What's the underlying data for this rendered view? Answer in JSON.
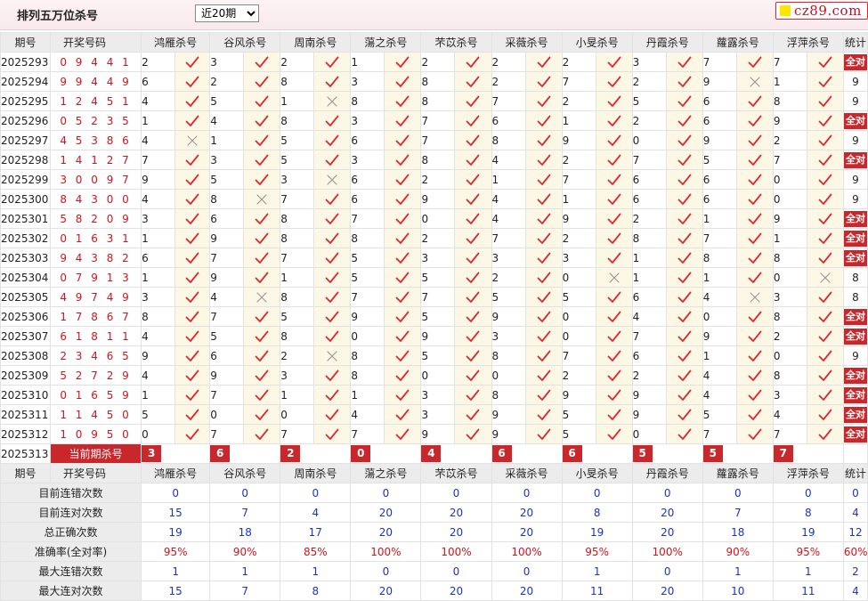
{
  "header": {
    "title": "排列五万位杀号",
    "range_selected": "近20期",
    "range_options": [
      "近20期"
    ],
    "site_logo": "cz89.com",
    "colors": {
      "accent": "#c8282c",
      "winning": "#d0141c",
      "stat_value": "#1a33c8"
    }
  },
  "columns": {
    "period": "期号",
    "draw": "开奖号码",
    "experts": [
      "鸿雁杀号",
      "谷风杀号",
      "周南杀号",
      "蕩之杀号",
      "芣苡杀号",
      "采薇杀号",
      "小旻杀号",
      "丹霞杀号",
      "蘿露杀号",
      "浮萍杀号"
    ],
    "stats": "统计"
  },
  "rows": [
    {
      "period": "2025293",
      "draw": "09441",
      "p": [
        2,
        3,
        2,
        1,
        2,
        2,
        2,
        3,
        7,
        7
      ],
      "ok": [
        1,
        1,
        1,
        1,
        1,
        1,
        1,
        1,
        1,
        1
      ],
      "stat": "全对"
    },
    {
      "period": "2025294",
      "draw": "99449",
      "p": [
        6,
        2,
        8,
        3,
        8,
        2,
        7,
        2,
        9,
        1
      ],
      "ok": [
        1,
        1,
        1,
        1,
        1,
        1,
        1,
        1,
        0,
        1
      ],
      "stat": "9"
    },
    {
      "period": "2025295",
      "draw": "12451",
      "p": [
        4,
        5,
        1,
        8,
        8,
        7,
        2,
        5,
        6,
        8
      ],
      "ok": [
        1,
        1,
        0,
        1,
        1,
        1,
        1,
        1,
        1,
        1
      ],
      "stat": "9"
    },
    {
      "period": "2025296",
      "draw": "05235",
      "p": [
        1,
        4,
        8,
        3,
        7,
        6,
        1,
        2,
        6,
        9
      ],
      "ok": [
        1,
        1,
        1,
        1,
        1,
        1,
        1,
        1,
        1,
        1
      ],
      "stat": "全对"
    },
    {
      "period": "2025297",
      "draw": "45386",
      "p": [
        4,
        1,
        5,
        6,
        7,
        8,
        9,
        0,
        9,
        2
      ],
      "ok": [
        0,
        1,
        1,
        1,
        1,
        1,
        1,
        1,
        1,
        1
      ],
      "stat": "9"
    },
    {
      "period": "2025298",
      "draw": "14127",
      "p": [
        7,
        3,
        5,
        3,
        8,
        4,
        2,
        7,
        5,
        7
      ],
      "ok": [
        1,
        1,
        1,
        1,
        1,
        1,
        1,
        1,
        1,
        1
      ],
      "stat": "全对"
    },
    {
      "period": "2025299",
      "draw": "30097",
      "p": [
        9,
        5,
        3,
        6,
        2,
        1,
        7,
        6,
        6,
        0
      ],
      "ok": [
        1,
        1,
        0,
        1,
        1,
        1,
        1,
        1,
        1,
        1
      ],
      "stat": "9"
    },
    {
      "period": "2025300",
      "draw": "84300",
      "p": [
        4,
        8,
        7,
        6,
        9,
        4,
        1,
        6,
        6,
        0
      ],
      "ok": [
        1,
        0,
        1,
        1,
        1,
        1,
        1,
        1,
        1,
        1
      ],
      "stat": "9"
    },
    {
      "period": "2025301",
      "draw": "58209",
      "p": [
        3,
        6,
        8,
        7,
        0,
        4,
        9,
        2,
        1,
        9
      ],
      "ok": [
        1,
        1,
        1,
        1,
        1,
        1,
        1,
        1,
        1,
        1
      ],
      "stat": "全对"
    },
    {
      "period": "2025302",
      "draw": "01631",
      "p": [
        1,
        9,
        8,
        8,
        2,
        7,
        2,
        8,
        7,
        1
      ],
      "ok": [
        1,
        1,
        1,
        1,
        1,
        1,
        1,
        1,
        1,
        1
      ],
      "stat": "全对"
    },
    {
      "period": "2025303",
      "draw": "94382",
      "p": [
        6,
        7,
        7,
        5,
        3,
        3,
        3,
        1,
        8,
        8
      ],
      "ok": [
        1,
        1,
        1,
        1,
        1,
        1,
        1,
        1,
        1,
        1
      ],
      "stat": "全对"
    },
    {
      "period": "2025304",
      "draw": "07913",
      "p": [
        1,
        9,
        1,
        5,
        5,
        2,
        0,
        1,
        1,
        0
      ],
      "ok": [
        1,
        1,
        1,
        1,
        1,
        1,
        0,
        1,
        1,
        0
      ],
      "stat": "8"
    },
    {
      "period": "2025305",
      "draw": "49749",
      "p": [
        3,
        4,
        8,
        7,
        7,
        5,
        5,
        6,
        4,
        3
      ],
      "ok": [
        1,
        0,
        1,
        1,
        1,
        1,
        1,
        1,
        0,
        1
      ],
      "stat": "8"
    },
    {
      "period": "2025306",
      "draw": "17867",
      "p": [
        8,
        7,
        5,
        9,
        5,
        9,
        0,
        4,
        0,
        8
      ],
      "ok": [
        1,
        1,
        1,
        1,
        1,
        1,
        1,
        1,
        1,
        1
      ],
      "stat": "全对"
    },
    {
      "period": "2025307",
      "draw": "61811",
      "p": [
        4,
        5,
        8,
        0,
        9,
        3,
        0,
        7,
        9,
        2
      ],
      "ok": [
        1,
        1,
        1,
        1,
        1,
        1,
        1,
        1,
        1,
        1
      ],
      "stat": "全对"
    },
    {
      "period": "2025308",
      "draw": "23465",
      "p": [
        9,
        6,
        2,
        8,
        5,
        8,
        7,
        6,
        1,
        0
      ],
      "ok": [
        1,
        1,
        0,
        1,
        1,
        1,
        1,
        1,
        1,
        1
      ],
      "stat": "9"
    },
    {
      "period": "2025309",
      "draw": "52729",
      "p": [
        4,
        9,
        3,
        8,
        0,
        0,
        2,
        2,
        4,
        8
      ],
      "ok": [
        1,
        1,
        1,
        1,
        1,
        1,
        1,
        1,
        1,
        1
      ],
      "stat": "全对"
    },
    {
      "period": "2025310",
      "draw": "01659",
      "p": [
        1,
        7,
        1,
        1,
        3,
        8,
        9,
        9,
        4,
        3
      ],
      "ok": [
        1,
        1,
        1,
        1,
        1,
        1,
        1,
        1,
        1,
        1
      ],
      "stat": "全对"
    },
    {
      "period": "2025311",
      "draw": "11450",
      "p": [
        5,
        0,
        0,
        4,
        3,
        9,
        5,
        9,
        5,
        4
      ],
      "ok": [
        1,
        1,
        1,
        1,
        1,
        1,
        1,
        1,
        1,
        1
      ],
      "stat": "全对"
    },
    {
      "period": "2025312",
      "draw": "10950",
      "p": [
        0,
        7,
        7,
        7,
        9,
        9,
        5,
        0,
        7,
        7
      ],
      "ok": [
        1,
        1,
        1,
        1,
        1,
        1,
        1,
        1,
        1,
        1
      ],
      "stat": "全对"
    }
  ],
  "current": {
    "period": "2025313",
    "label": "当前期杀号",
    "picks": [
      "3",
      "6",
      "2",
      "0",
      "4",
      "6",
      "6",
      "5",
      "5",
      "7"
    ]
  },
  "summary": [
    {
      "label": "目前连错次数",
      "values": [
        "0",
        "0",
        "0",
        "0",
        "0",
        "0",
        "0",
        "0",
        "0",
        "0"
      ],
      "total": "0",
      "red": false
    },
    {
      "label": "目前连对次数",
      "values": [
        "15",
        "7",
        "4",
        "20",
        "20",
        "20",
        "8",
        "20",
        "7",
        "8"
      ],
      "total": "4",
      "red": false
    },
    {
      "label": "总正确次数",
      "values": [
        "19",
        "18",
        "17",
        "20",
        "20",
        "20",
        "19",
        "20",
        "18",
        "19"
      ],
      "total": "12",
      "red": false
    },
    {
      "label": "准确率(全对率)",
      "values": [
        "95%",
        "90%",
        "85%",
        "100%",
        "100%",
        "100%",
        "95%",
        "100%",
        "90%",
        "95%"
      ],
      "total": "60%",
      "red": true
    },
    {
      "label": "最大连错次数",
      "values": [
        "1",
        "1",
        "1",
        "0",
        "0",
        "0",
        "1",
        "0",
        "1",
        "1"
      ],
      "total": "2",
      "red": false
    },
    {
      "label": "最大连对次数",
      "values": [
        "15",
        "7",
        "8",
        "20",
        "20",
        "20",
        "11",
        "20",
        "10",
        "11"
      ],
      "total": "4",
      "red": false
    }
  ]
}
